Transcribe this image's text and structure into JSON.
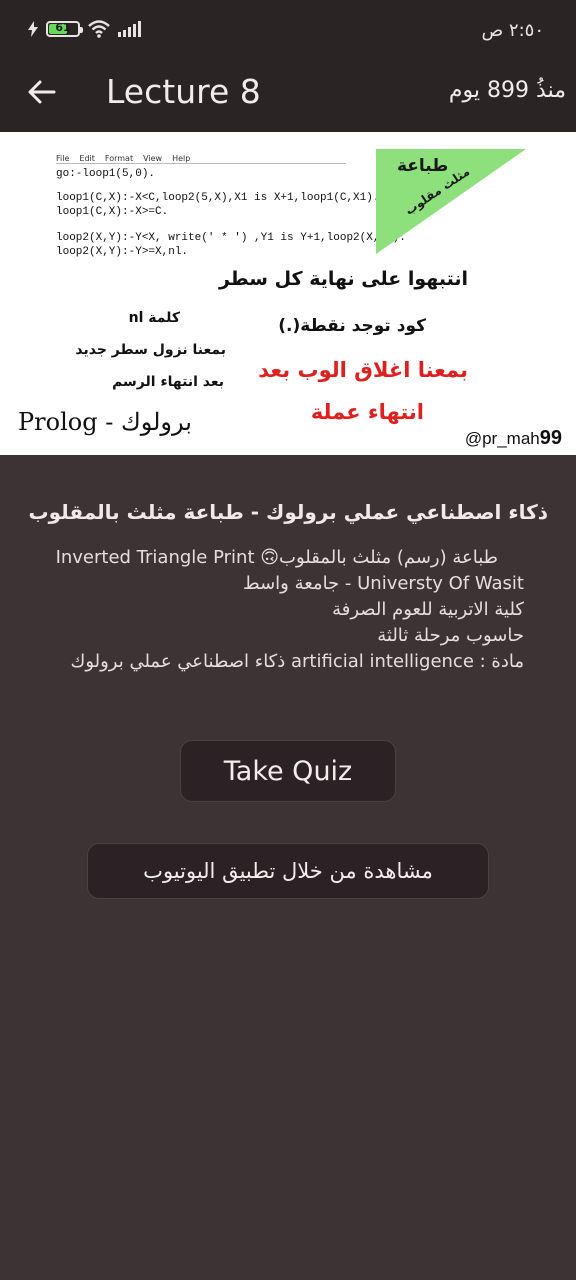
{
  "status_bar": {
    "battery_level": "61",
    "time": "٢:٥٠ ص"
  },
  "app_bar": {
    "title": "Lecture 8",
    "since": "منذُ 899 يوم"
  },
  "thumbnail": {
    "menu": [
      "File",
      "Edit",
      "Format",
      "View",
      "Help"
    ],
    "code_lines": [
      "go:-loop1(5,0).",
      "loop1(C,X):-X<C,loop2(5,X),X1 is X+1,loop1(C,X1).",
      "loop1(C,X):-X>=C.",
      "loop2(X,Y):-Y<X, write(' * ') ,Y1 is Y+1,loop2(X,Y1).",
      "loop2(X,Y):-Y>=X,nl."
    ],
    "triangle_line1": "طباعة",
    "triangle_line2": "مثلث مقلوب",
    "note1": "انتبهوا على نهاية كل سطر",
    "note2": "كود توجد نقطة(.)",
    "note3": "بمعنا اغلاق الوب بعد",
    "note4": "انتهاء عملة",
    "nl_word": "كلمة nl",
    "nl_meaning1": "بمعنا نزول سطر جديد",
    "nl_meaning2": "بعد انتهاء الرسم",
    "prolog_label": "Prolog - برولوك",
    "handle_prefix": "@pr_mah",
    "handle_suffix": "99"
  },
  "content": {
    "title": "ذكاء اصطناعي عملي برولوك - طباعة مثلث بالمقلوب",
    "description": [
      "طباعة (رسم) مثلث بالمقلوب🙃 Inverted Triangle Print",
      "Universty Of Wasit  - جامعة واسط",
      "كلية الاتربية للعوم الصرفة",
      "حاسوب مرحلة ثالثة",
      "مادة : artificial intelligence  ذكاء اصطناعي عملي برولوك"
    ]
  },
  "buttons": {
    "quiz": "Take Quiz",
    "youtube": "مشاهدة من خلال تطبيق اليوتيوب"
  },
  "colors": {
    "background": "#3b3334",
    "bar": "#2b2425",
    "triangle": "#8de07c",
    "red_note": "#e01f1f",
    "battery": "#66d95a"
  }
}
